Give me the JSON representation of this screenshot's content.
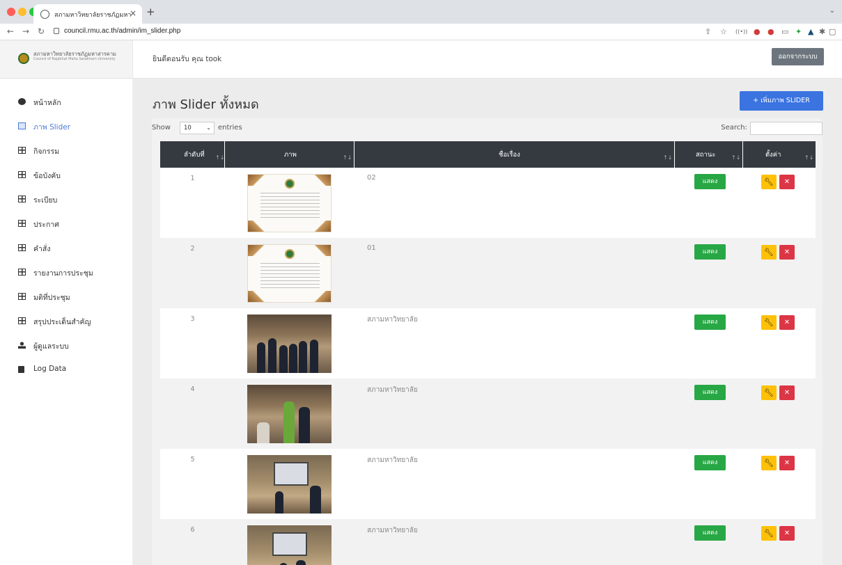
{
  "browser": {
    "tab_title": "สภามหาวิทยาลัยราชภัฏมหาสารคาม",
    "tab_close": "×",
    "new_tab": "+",
    "url": "council.rmu.ac.th/admin/im_slider.php"
  },
  "brand": {
    "name": "สภามหาวิทยาลัยราชภัฏมหาสารคาม",
    "subtitle": "Council of Rajabhat Maha Sarakham University"
  },
  "topbar": {
    "welcome": "ยินดีตอนรับ คุณ took",
    "logout_label": "ออกจากระบบ"
  },
  "sidebar": {
    "items": [
      {
        "label": "หน้าหลัก",
        "icon": "dashboard-icon"
      },
      {
        "label": "ภาพ Slider",
        "icon": "image-icon",
        "active": true
      },
      {
        "label": "กิจกรรม",
        "icon": "table-icon"
      },
      {
        "label": "ข้อบังคับ",
        "icon": "table-icon"
      },
      {
        "label": "ระเบียบ",
        "icon": "table-icon"
      },
      {
        "label": "ประกาศ",
        "icon": "table-icon"
      },
      {
        "label": "คำสั่ง",
        "icon": "table-icon"
      },
      {
        "label": "รายงานการประชุม",
        "icon": "table-icon"
      },
      {
        "label": "มติที่ประชุม",
        "icon": "table-icon"
      },
      {
        "label": "สรุปประเด็นสำคัญ",
        "icon": "table-icon"
      },
      {
        "label": "ผู้ดูแลระบบ",
        "icon": "user-icon"
      },
      {
        "label": "Log Data",
        "icon": "file-icon"
      }
    ]
  },
  "main": {
    "title": "ภาพ Slider ทั้งหมด",
    "add_button": "+ เพิ่มภาพ SLIDER",
    "show_label": "Show",
    "entries_value": "10",
    "entries_label": "entries",
    "search_label": "Search:",
    "columns": [
      "ลำดับที่",
      "ภาพ",
      "ชื่อเรื่อง",
      "สถานะ",
      "ตั้งค่า"
    ],
    "rows": [
      {
        "no": "1",
        "title": "02",
        "status": "แสดง",
        "image": "certificate"
      },
      {
        "no": "2",
        "title": "01",
        "status": "แสดง",
        "image": "certificate"
      },
      {
        "no": "3",
        "title": "สภามหาวิทยาลัย",
        "status": "แสดง",
        "image": "group-photo"
      },
      {
        "no": "4",
        "title": "สภามหาวิทยาลัย",
        "status": "แสดง",
        "image": "desk-photo"
      },
      {
        "no": "5",
        "title": "สภามหาวิทยาลัย",
        "status": "แสดง",
        "image": "meeting-photo"
      },
      {
        "no": "6",
        "title": "สภามหาวิทยาลัย",
        "status": "แสดง",
        "image": "meeting-photo"
      }
    ]
  },
  "colors": {
    "primary": "#3b73e0",
    "success": "#28a745",
    "warning": "#ffc107",
    "danger": "#dc3545",
    "header_dark": "#343a40",
    "sidebar_active": "#4a7ad8"
  }
}
